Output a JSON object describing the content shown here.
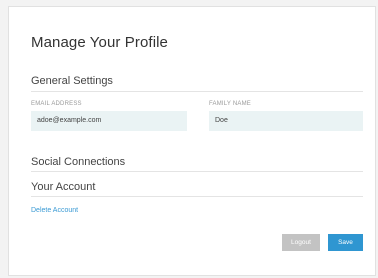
{
  "page": {
    "title": "Manage Your Profile"
  },
  "general_settings": {
    "heading": "General Settings",
    "email": {
      "label": "EMAIL ADDRESS",
      "value": "adoe@example.com"
    },
    "family_name": {
      "label": "FAMILY NAME",
      "value": "Doe"
    }
  },
  "social_connections": {
    "heading": "Social Connections"
  },
  "your_account": {
    "heading": "Your Account",
    "delete_link": "Delete Account"
  },
  "actions": {
    "logout_label": "Logout",
    "save_label": "Save"
  },
  "colors": {
    "accent": "#2f96d1",
    "link": "#3a9ad4",
    "input_bg": "#eaf3f4",
    "logout_bg": "#c3c3c3"
  }
}
